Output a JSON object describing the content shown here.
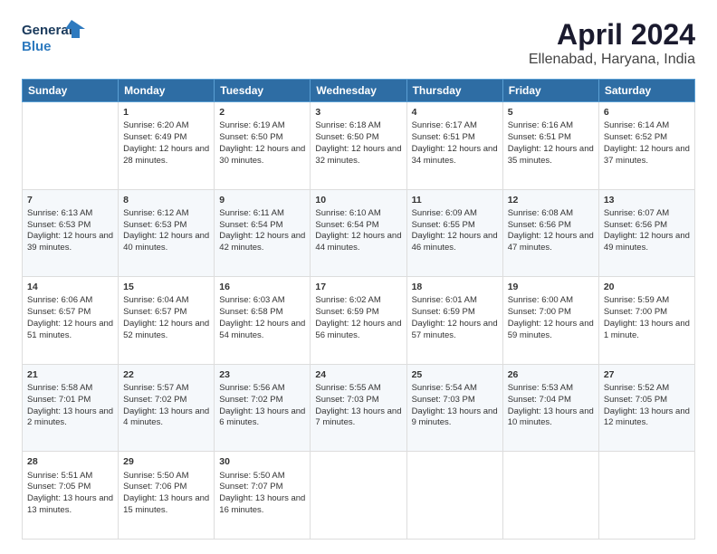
{
  "header": {
    "logo_general": "General",
    "logo_blue": "Blue",
    "title": "April 2024",
    "subtitle": "Ellenabad, Haryana, India"
  },
  "columns": [
    "Sunday",
    "Monday",
    "Tuesday",
    "Wednesday",
    "Thursday",
    "Friday",
    "Saturday"
  ],
  "weeks": [
    [
      {
        "day": "",
        "text": ""
      },
      {
        "day": "1",
        "text": "Sunrise: 6:20 AM\nSunset: 6:49 PM\nDaylight: 12 hours and 28 minutes."
      },
      {
        "day": "2",
        "text": "Sunrise: 6:19 AM\nSunset: 6:50 PM\nDaylight: 12 hours and 30 minutes."
      },
      {
        "day": "3",
        "text": "Sunrise: 6:18 AM\nSunset: 6:50 PM\nDaylight: 12 hours and 32 minutes."
      },
      {
        "day": "4",
        "text": "Sunrise: 6:17 AM\nSunset: 6:51 PM\nDaylight: 12 hours and 34 minutes."
      },
      {
        "day": "5",
        "text": "Sunrise: 6:16 AM\nSunset: 6:51 PM\nDaylight: 12 hours and 35 minutes."
      },
      {
        "day": "6",
        "text": "Sunrise: 6:14 AM\nSunset: 6:52 PM\nDaylight: 12 hours and 37 minutes."
      }
    ],
    [
      {
        "day": "7",
        "text": "Sunrise: 6:13 AM\nSunset: 6:53 PM\nDaylight: 12 hours and 39 minutes."
      },
      {
        "day": "8",
        "text": "Sunrise: 6:12 AM\nSunset: 6:53 PM\nDaylight: 12 hours and 40 minutes."
      },
      {
        "day": "9",
        "text": "Sunrise: 6:11 AM\nSunset: 6:54 PM\nDaylight: 12 hours and 42 minutes."
      },
      {
        "day": "10",
        "text": "Sunrise: 6:10 AM\nSunset: 6:54 PM\nDaylight: 12 hours and 44 minutes."
      },
      {
        "day": "11",
        "text": "Sunrise: 6:09 AM\nSunset: 6:55 PM\nDaylight: 12 hours and 46 minutes."
      },
      {
        "day": "12",
        "text": "Sunrise: 6:08 AM\nSunset: 6:56 PM\nDaylight: 12 hours and 47 minutes."
      },
      {
        "day": "13",
        "text": "Sunrise: 6:07 AM\nSunset: 6:56 PM\nDaylight: 12 hours and 49 minutes."
      }
    ],
    [
      {
        "day": "14",
        "text": "Sunrise: 6:06 AM\nSunset: 6:57 PM\nDaylight: 12 hours and 51 minutes."
      },
      {
        "day": "15",
        "text": "Sunrise: 6:04 AM\nSunset: 6:57 PM\nDaylight: 12 hours and 52 minutes."
      },
      {
        "day": "16",
        "text": "Sunrise: 6:03 AM\nSunset: 6:58 PM\nDaylight: 12 hours and 54 minutes."
      },
      {
        "day": "17",
        "text": "Sunrise: 6:02 AM\nSunset: 6:59 PM\nDaylight: 12 hours and 56 minutes."
      },
      {
        "day": "18",
        "text": "Sunrise: 6:01 AM\nSunset: 6:59 PM\nDaylight: 12 hours and 57 minutes."
      },
      {
        "day": "19",
        "text": "Sunrise: 6:00 AM\nSunset: 7:00 PM\nDaylight: 12 hours and 59 minutes."
      },
      {
        "day": "20",
        "text": "Sunrise: 5:59 AM\nSunset: 7:00 PM\nDaylight: 13 hours and 1 minute."
      }
    ],
    [
      {
        "day": "21",
        "text": "Sunrise: 5:58 AM\nSunset: 7:01 PM\nDaylight: 13 hours and 2 minutes."
      },
      {
        "day": "22",
        "text": "Sunrise: 5:57 AM\nSunset: 7:02 PM\nDaylight: 13 hours and 4 minutes."
      },
      {
        "day": "23",
        "text": "Sunrise: 5:56 AM\nSunset: 7:02 PM\nDaylight: 13 hours and 6 minutes."
      },
      {
        "day": "24",
        "text": "Sunrise: 5:55 AM\nSunset: 7:03 PM\nDaylight: 13 hours and 7 minutes."
      },
      {
        "day": "25",
        "text": "Sunrise: 5:54 AM\nSunset: 7:03 PM\nDaylight: 13 hours and 9 minutes."
      },
      {
        "day": "26",
        "text": "Sunrise: 5:53 AM\nSunset: 7:04 PM\nDaylight: 13 hours and 10 minutes."
      },
      {
        "day": "27",
        "text": "Sunrise: 5:52 AM\nSunset: 7:05 PM\nDaylight: 13 hours and 12 minutes."
      }
    ],
    [
      {
        "day": "28",
        "text": "Sunrise: 5:51 AM\nSunset: 7:05 PM\nDaylight: 13 hours and 13 minutes."
      },
      {
        "day": "29",
        "text": "Sunrise: 5:50 AM\nSunset: 7:06 PM\nDaylight: 13 hours and 15 minutes."
      },
      {
        "day": "30",
        "text": "Sunrise: 5:50 AM\nSunset: 7:07 PM\nDaylight: 13 hours and 16 minutes."
      },
      {
        "day": "",
        "text": ""
      },
      {
        "day": "",
        "text": ""
      },
      {
        "day": "",
        "text": ""
      },
      {
        "day": "",
        "text": ""
      }
    ]
  ]
}
